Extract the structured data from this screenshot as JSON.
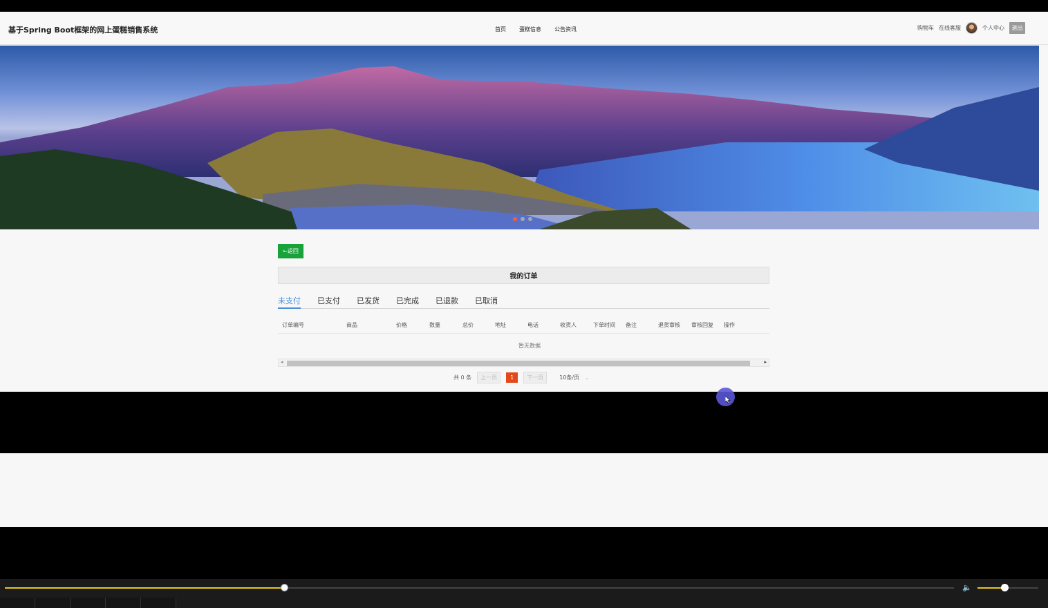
{
  "site": {
    "brand": "基于Spring Boot框架的网上蛋糕销售系统",
    "nav": [
      "首页",
      "蛋糕信息",
      "公告资讯"
    ],
    "right_nav": {
      "cart": "购物车",
      "service": "在线客服",
      "profile": "个人中心",
      "logout": "退出"
    }
  },
  "banner": {
    "slide_count": 3,
    "active_index": 0
  },
  "orders": {
    "back_label": "←返回",
    "title": "我的订单",
    "tabs": [
      "未支付",
      "已支付",
      "已发货",
      "已完成",
      "已退款",
      "已取消"
    ],
    "active_tab": "未支付",
    "columns": [
      "订单编号",
      "商品",
      "价格",
      "数量",
      "总价",
      "地址",
      "电话",
      "收货人",
      "下单时间",
      "备注",
      "退货审核",
      "审核回复",
      "操作"
    ],
    "empty_text": "暂无数据",
    "pagination": {
      "total_text": "共 0 条",
      "prev": "上一页",
      "current": "1",
      "next": "下一页",
      "page_size": "10条/页"
    }
  },
  "player": {
    "progress": 0.294,
    "volume": 0.447
  },
  "colors": {
    "primary_green": "#18a23a",
    "tab_active": "#4a8fd8",
    "page_current": "#e24a1b",
    "progress": "#e8c820"
  }
}
